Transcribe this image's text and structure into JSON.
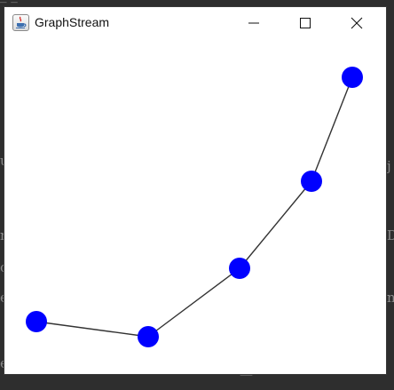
{
  "window": {
    "title": "GraphStream"
  },
  "title_bar_buttons": [
    "minimize",
    "maximize",
    "close"
  ],
  "icons": {
    "app": "java-cup-icon",
    "minimize": "minimize-icon",
    "maximize": "maximize-icon",
    "close": "close-icon"
  },
  "graph": {
    "node_color": "#0000ff",
    "edge_color": "#333333",
    "node_count": 5,
    "edge_count": 4
  },
  "colors": {
    "window_bg": "#ffffff",
    "desktop_bg": "#2e2e2e"
  }
}
